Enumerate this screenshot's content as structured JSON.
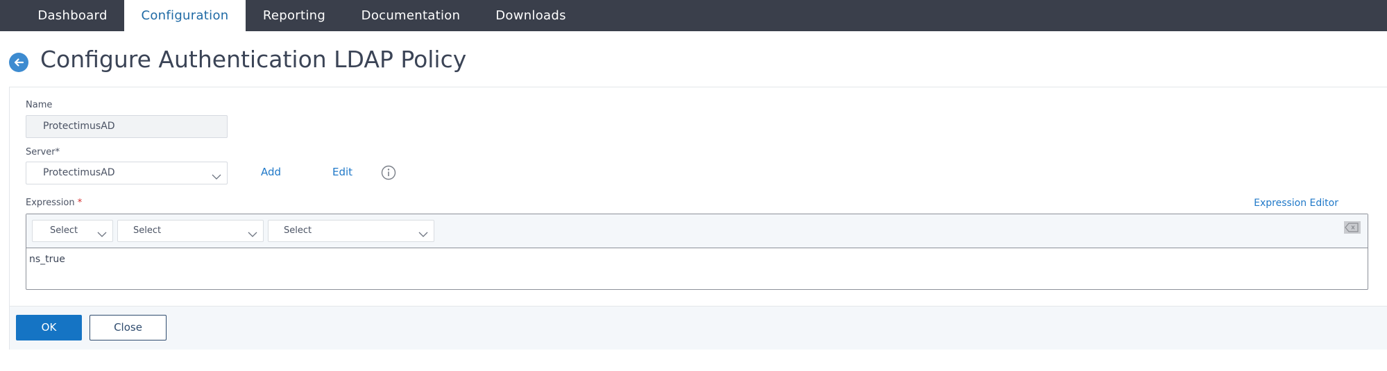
{
  "nav": {
    "tabs": [
      {
        "label": "Dashboard",
        "active": false
      },
      {
        "label": "Configuration",
        "active": true
      },
      {
        "label": "Reporting",
        "active": false
      },
      {
        "label": "Documentation",
        "active": false
      },
      {
        "label": "Downloads",
        "active": false
      }
    ]
  },
  "page": {
    "title": "Configure Authentication LDAP Policy",
    "back_icon": "arrow-left-circle-icon"
  },
  "form": {
    "name": {
      "label": "Name",
      "value": "ProtectimusAD"
    },
    "server": {
      "label": "Server*",
      "selected": "ProtectimusAD",
      "add_label": "Add",
      "edit_label": "Edit",
      "info_icon": "info-circle-icon"
    },
    "expression": {
      "label": "Expression",
      "required_mark": "*",
      "editor_link": "Expression Editor",
      "selects": [
        "Select",
        "Select",
        "Select"
      ],
      "clear_icon": "backspace-icon",
      "value": "ns_true"
    }
  },
  "actions": {
    "ok_label": "OK",
    "close_label": "Close"
  },
  "colors": {
    "nav_bg": "#3a3f4b",
    "active_tab_text": "#1f6aa5",
    "link": "#1f78c8",
    "primary_button": "#1574c4",
    "required": "#d42c2c"
  }
}
